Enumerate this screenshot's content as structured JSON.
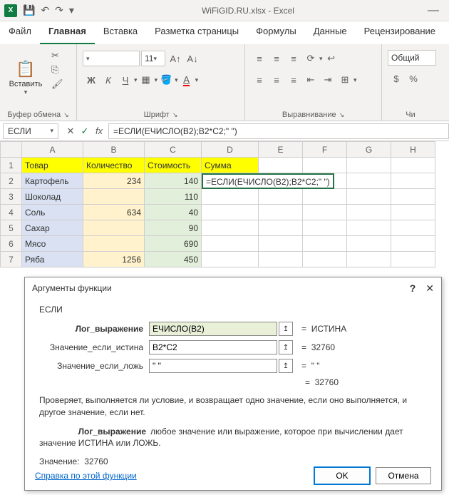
{
  "titlebar": {
    "doc": "WiFiGID.RU.xlsx - Excel"
  },
  "tabs": {
    "t0": "Файл",
    "t1": "Главная",
    "t2": "Вставка",
    "t3": "Разметка страницы",
    "t4": "Формулы",
    "t5": "Данные",
    "t6": "Рецензирование"
  },
  "ribbon": {
    "paste": "Вставить",
    "clipboard": "Буфер обмена",
    "font": "Шрифт",
    "align": "Выравнивание",
    "num": "Чи",
    "font_size": "11",
    "bold": "Ж",
    "italic": "К",
    "underline": "Ч",
    "numfmt": "Общий"
  },
  "formula": {
    "name": "ЕСЛИ",
    "fx": "fx",
    "content": "=ЕСЛИ(ЕЧИСЛО(B2);B2*C2;\" \")"
  },
  "cols": [
    "",
    "A",
    "B",
    "C",
    "D",
    "E",
    "F",
    "G",
    "H"
  ],
  "headers": {
    "a": "Товар",
    "b": "Количество",
    "c": "Стоимость",
    "d": "Сумма"
  },
  "rows": [
    {
      "a": "Картофель",
      "b": "234",
      "c": "140",
      "d": "=ЕСЛИ(ЕЧИСЛО(B2);B2*C2;\" \")"
    },
    {
      "a": "Шоколад",
      "b": "",
      "c": "110",
      "d": ""
    },
    {
      "a": "Соль",
      "b": "634",
      "c": "40",
      "d": ""
    },
    {
      "a": "Сахар",
      "b": "",
      "c": "90",
      "d": ""
    },
    {
      "a": "Мясо",
      "b": "",
      "c": "690",
      "d": ""
    },
    {
      "a": "Ряба",
      "b": "1256",
      "c": "450",
      "d": ""
    }
  ],
  "dialog": {
    "title": "Аргументы функции",
    "func": "ЕСЛИ",
    "arg1_label": "Лог_выражение",
    "arg1_val": "ЕЧИСЛО(B2)",
    "arg1_res": "ИСТИНА",
    "arg2_label": "Значение_если_истина",
    "arg2_val": "B2*C2",
    "arg2_res": "32760",
    "arg3_label": "Значение_если_ложь",
    "arg3_val": "\" \"",
    "arg3_res": "\" \"",
    "final_res": "32760",
    "desc": "Проверяет, выполняется ли условие, и возвращает одно значение, если оно выполняется, и другое значение, если нет.",
    "arghelp_label": "Лог_выражение",
    "arghelp": "любое значение или выражение, которое при вычислении дает значение ИСТИНА или ЛОЖЬ.",
    "value_label": "Значение:",
    "value": "32760",
    "help": "Справка по этой функции",
    "ok": "OK",
    "cancel": "Отмена",
    "eq": "="
  }
}
